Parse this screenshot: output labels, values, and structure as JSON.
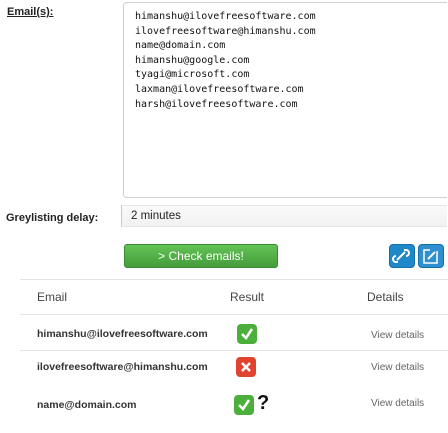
{
  "form": {
    "emails_label": "Email(s):",
    "emails": [
      "himanshu@ilovefreesoftware.com",
      "ilovefreesoftware@himanshu.com",
      "name@domain.com",
      "himanshu@google.com",
      "tyagi@microsoft.com",
      "laxman@ilovefreesoftware.com",
      "harsh@ilovefreesoftware.com"
    ],
    "greylisting_label": "Greylisting delay:",
    "greylisting_value": "2 minutes",
    "check_button": "> Check emails!"
  },
  "table": {
    "headers": {
      "email": "Email",
      "result": "Result",
      "details": "Details"
    },
    "rows": [
      {
        "email": "himanshu@ilovefreesoftware.com",
        "status": "valid",
        "details": "View details"
      },
      {
        "email": "ilovefreesoftware@himanshu.com",
        "status": "invalid",
        "details": "View details"
      },
      {
        "email": "name@domain.com",
        "status": "unknown",
        "unknown_mark": "?",
        "details": "View details"
      }
    ]
  },
  "colors": {
    "valid": "#4caf3c",
    "invalid": "#e0432f",
    "button": "#56b04a",
    "share": "#1e88c8"
  },
  "icons": {
    "valid": "check-icon",
    "invalid": "cross-icon",
    "unknown": "question-icon",
    "share": "share-icon",
    "edit": "edit-icon"
  }
}
